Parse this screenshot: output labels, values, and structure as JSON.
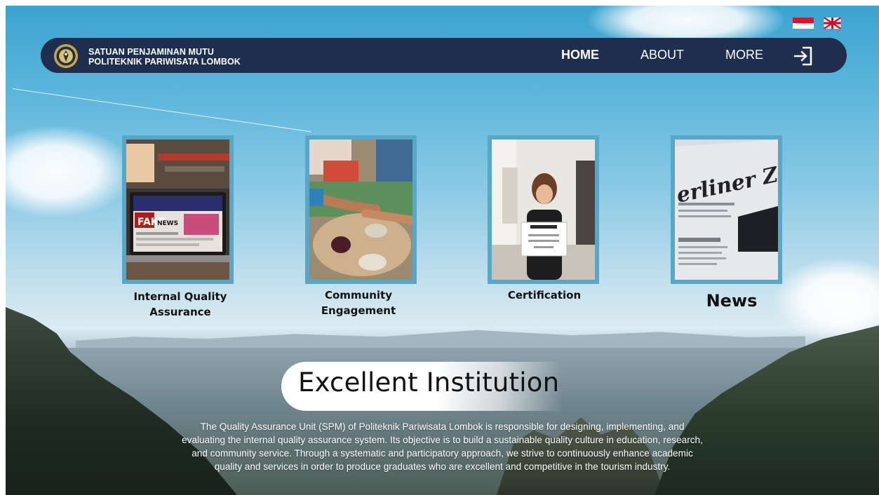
{
  "brand": {
    "line1": "SATUAN PENJAMINAN MUTU",
    "line2": "POLITEKNIK PARIWISATA LOMBOK",
    "logo_icon": "institution-seal-icon"
  },
  "languages": [
    {
      "icon": "flag-indonesia-icon"
    },
    {
      "icon": "flag-uk-icon"
    }
  ],
  "nav": {
    "home": "HOME",
    "about": "ABOUT",
    "more": "MORE",
    "login_icon": "login-arrow-icon"
  },
  "cards": [
    {
      "label": "Internal Quality Assurance",
      "image": "laptop-fake-news-photo"
    },
    {
      "label": "Community Engagement",
      "image": "community-hands-food-photo"
    },
    {
      "label": "Certification",
      "image": "woman-holding-certificate-photo"
    },
    {
      "label": "News",
      "image": "newspaper-photo"
    }
  ],
  "hero": {
    "title": "Excellent Institution",
    "description": "The Quality Assurance Unit (SPM) of Politeknik Pariwisata Lombok is responsible for designing, implementing, and evaluating the internal quality assurance system. Its objective is to build a sustainable quality culture in education, research, and community service. Through a systematic and participatory approach, we strive to continuously enhance academic quality and services in order to produce graduates who are excellent and competitive in the tourism industry."
  },
  "colors": {
    "navbar": "#1e2e4e",
    "card_frame": "#5aa6c6",
    "sky_top": "#3aa3cf"
  }
}
